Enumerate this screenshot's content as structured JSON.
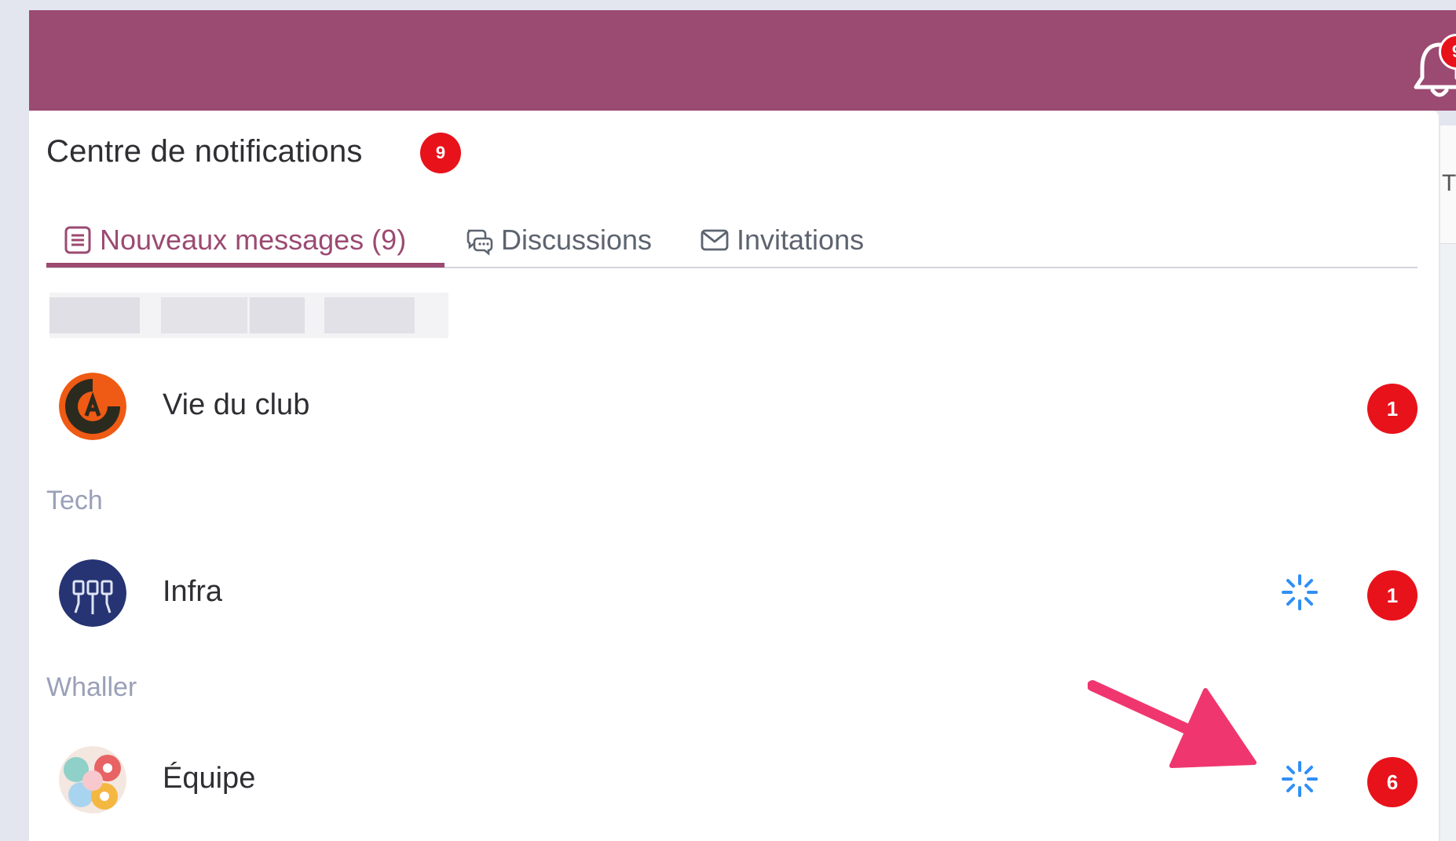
{
  "notifications_count": "9",
  "panel": {
    "title": "Centre de notifications",
    "title_badge": "9"
  },
  "tabs": [
    {
      "label": "Nouveaux messages (9)",
      "icon": "list-icon",
      "active": true
    },
    {
      "label": "Discussions",
      "icon": "chat-bubbles-icon",
      "active": false
    },
    {
      "label": "Invitations",
      "icon": "envelope-icon",
      "active": false
    }
  ],
  "rows": {
    "vie_du_club": {
      "label": "Vie du club",
      "count": "1"
    },
    "infra": {
      "label": "Infra",
      "count": "1"
    },
    "equipe": {
      "label": "Équipe",
      "count": "6"
    }
  },
  "sections": {
    "tech": "Tech",
    "whaller": "Whaller"
  },
  "background": {
    "right_letter": "T"
  },
  "colors": {
    "header": "#9b4a72",
    "accent": "#9b4a72",
    "badge": "#e8121b",
    "section_text": "#9aa0b8",
    "spark": "#2f8ff5",
    "arrow": "#f0366f"
  }
}
